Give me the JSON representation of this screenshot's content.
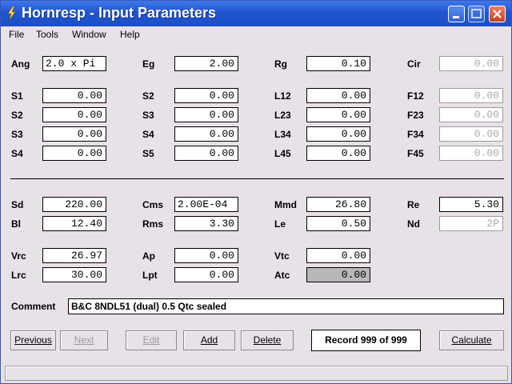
{
  "window": {
    "title": "Hornresp - Input Parameters"
  },
  "menu": [
    "File",
    "Tools",
    "Window",
    "Help"
  ],
  "rows": [
    [
      {
        "label": "Ang",
        "value": "2.0 x Pi",
        "mono_left": true
      },
      {
        "label": "Eg",
        "value": "2.00"
      },
      {
        "label": "Rg",
        "value": "0.10"
      },
      {
        "label": "Cir",
        "value": "0.00",
        "dim": true
      }
    ],
    [
      {
        "label": "S1",
        "value": "0.00"
      },
      {
        "label": "S2",
        "value": "0.00"
      },
      {
        "label": "L12",
        "value": "0.00"
      },
      {
        "label": "F12",
        "value": "0.00",
        "dim": true
      }
    ],
    [
      {
        "label": "S2",
        "value": "0.00"
      },
      {
        "label": "S3",
        "value": "0.00"
      },
      {
        "label": "L23",
        "value": "0.00"
      },
      {
        "label": "F23",
        "value": "0.00",
        "dim": true
      }
    ],
    [
      {
        "label": "S3",
        "value": "0.00"
      },
      {
        "label": "S4",
        "value": "0.00"
      },
      {
        "label": "L34",
        "value": "0.00"
      },
      {
        "label": "F34",
        "value": "0.00",
        "dim": true
      }
    ],
    [
      {
        "label": "S4",
        "value": "0.00"
      },
      {
        "label": "S5",
        "value": "0.00"
      },
      {
        "label": "L45",
        "value": "0.00"
      },
      {
        "label": "F45",
        "value": "0.00",
        "dim": true
      }
    ],
    [
      {
        "label": "Sd",
        "value": "220.00"
      },
      {
        "label": "Cms",
        "value": "2.00E-04",
        "mono_left": true
      },
      {
        "label": "Mmd",
        "value": "26.80"
      },
      {
        "label": "Re",
        "value": "5.30"
      }
    ],
    [
      {
        "label": "Bl",
        "value": "12.40"
      },
      {
        "label": "Rms",
        "value": "3.30"
      },
      {
        "label": "Le",
        "value": "0.50"
      },
      {
        "label": "Nd",
        "value": "2P",
        "dim": true
      }
    ],
    [
      {
        "label": "Vrc",
        "value": "26.97"
      },
      {
        "label": "Ap",
        "value": "0.00"
      },
      {
        "label": "Vtc",
        "value": "0.00"
      },
      null
    ],
    [
      {
        "label": "Lrc",
        "value": "30.00"
      },
      {
        "label": "Lpt",
        "value": "0.00"
      },
      {
        "label": "Atc",
        "value": "0.00",
        "grey": true
      },
      null
    ]
  ],
  "comment": {
    "label": "Comment",
    "value": "B&C 8NDL51 (dual) 0.5 Qtc sealed"
  },
  "buttons": {
    "previous": "Previous",
    "next": "Next",
    "edit": "Edit",
    "add": "Add",
    "delete": "Delete",
    "calculate": "Calculate"
  },
  "record": "Record 999 of 999",
  "colors": {
    "titlebar": "#2055d0",
    "window_bg": "#e8e1e8",
    "disabled_text": "#9a9a9a"
  }
}
